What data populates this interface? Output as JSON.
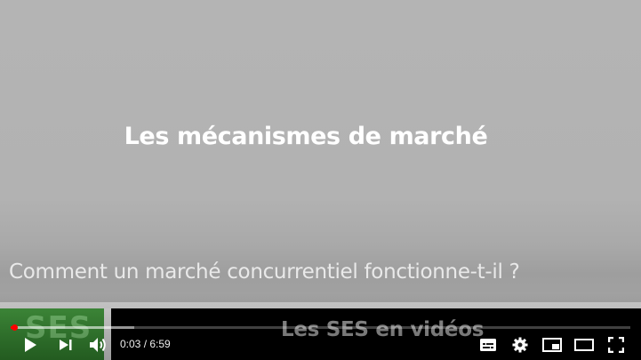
{
  "video": {
    "slide_title": "Les mécanismes de marché",
    "slide_subtitle": "Comment un marché concurrentiel fonctionne-t-il ?",
    "logo_text": "SES",
    "banner_text": "Les SES en vidéos"
  },
  "player": {
    "current_time": "0:03",
    "separator": " / ",
    "duration": "6:59",
    "progress_fraction": 0.007,
    "buffered_fraction": 0.2,
    "accent_color": "#ff0000"
  },
  "icons": {
    "left": [
      "play-icon",
      "next-icon",
      "volume-icon"
    ],
    "right": [
      "subtitles-icon",
      "settings-icon",
      "miniplayer-icon",
      "theater-mode-icon",
      "fullscreen-icon"
    ]
  }
}
